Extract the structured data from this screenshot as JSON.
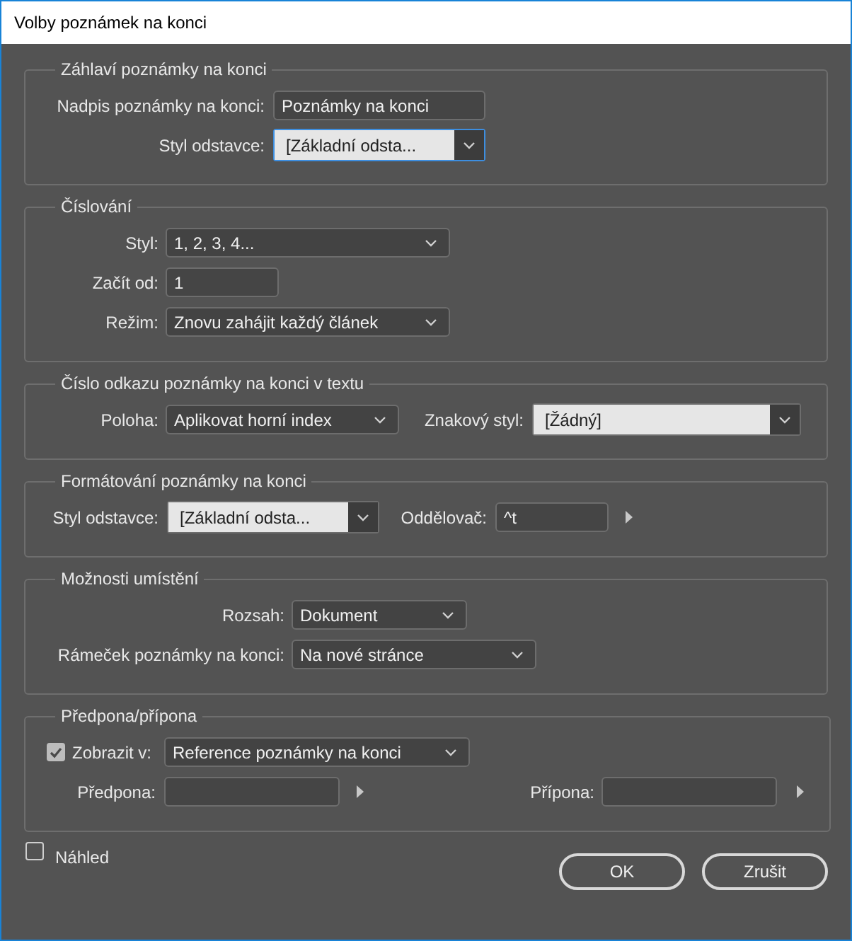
{
  "window": {
    "title": "Volby poznámek na konci"
  },
  "sections": [
    {
      "title": "Záhlaví poznámky na konci",
      "rows": [
        [
          {
            "kind": "label",
            "text": "Nadpis poznámky na konci:"
          },
          {
            "kind": "field",
            "value": "Poznámky na konci"
          }
        ],
        [
          {
            "kind": "label",
            "text": "Styl odstavce:"
          },
          {
            "kind": "combo",
            "value": "[Základní odsta...",
            "focused": true
          }
        ]
      ]
    },
    {
      "title": "Číslování",
      "rows": [
        [
          {
            "kind": "label",
            "text": "Styl:"
          },
          {
            "kind": "dropdown",
            "value": "1, 2, 3, 4..."
          }
        ],
        [
          {
            "kind": "label",
            "text": "Začít od:"
          },
          {
            "kind": "field",
            "value": "1"
          }
        ],
        [
          {
            "kind": "label",
            "text": "Režim:"
          },
          {
            "kind": "dropdown",
            "value": "Znovu zahájit každý článek"
          }
        ]
      ]
    },
    {
      "title": "Číslo odkazu poznámky na konci v textu",
      "rows": [
        [
          {
            "kind": "label",
            "text": "Poloha:"
          },
          {
            "kind": "dropdown",
            "value": "Aplikovat horní index"
          },
          {
            "kind": "label",
            "text": "Znakový styl:"
          },
          {
            "kind": "combo",
            "value": "[Žádný]",
            "focused": false
          }
        ]
      ]
    },
    {
      "title": "Formátování poznámky na konci",
      "rows": [
        [
          {
            "kind": "label",
            "text": "Styl odstavce:"
          },
          {
            "kind": "combo",
            "value": "[Základní odsta...",
            "focused": false
          },
          {
            "kind": "label",
            "text": "Oddělovač:"
          },
          {
            "kind": "field",
            "value": "^t"
          },
          {
            "kind": "arrow"
          }
        ]
      ]
    },
    {
      "title": "Možnosti umístění",
      "rows": [
        [
          {
            "kind": "label",
            "text": "Rozsah:"
          },
          {
            "kind": "dropdown",
            "value": "Dokument"
          }
        ],
        [
          {
            "kind": "label",
            "text": "Rámeček poznámky na konci:"
          },
          {
            "kind": "dropdown",
            "value": "Na nové stránce"
          }
        ]
      ]
    },
    {
      "title": "Předpona/přípona",
      "rows": [
        [
          {
            "kind": "checkbox",
            "checked": true
          },
          {
            "kind": "label",
            "text": "Zobrazit v:"
          },
          {
            "kind": "dropdown",
            "value": "Reference poznámky na konci"
          }
        ],
        [
          {
            "kind": "label",
            "text": "Předpona:"
          },
          {
            "kind": "field"
          },
          {
            "kind": "arrow"
          },
          {
            "kind": "label",
            "text": "Přípona:"
          },
          {
            "kind": "field"
          },
          {
            "kind": "arrow"
          }
        ]
      ]
    }
  ],
  "preview": {
    "label": "Náhled",
    "checked": false
  },
  "buttons": [
    {
      "label": "OK"
    },
    {
      "label": "Zrušit"
    }
  ]
}
